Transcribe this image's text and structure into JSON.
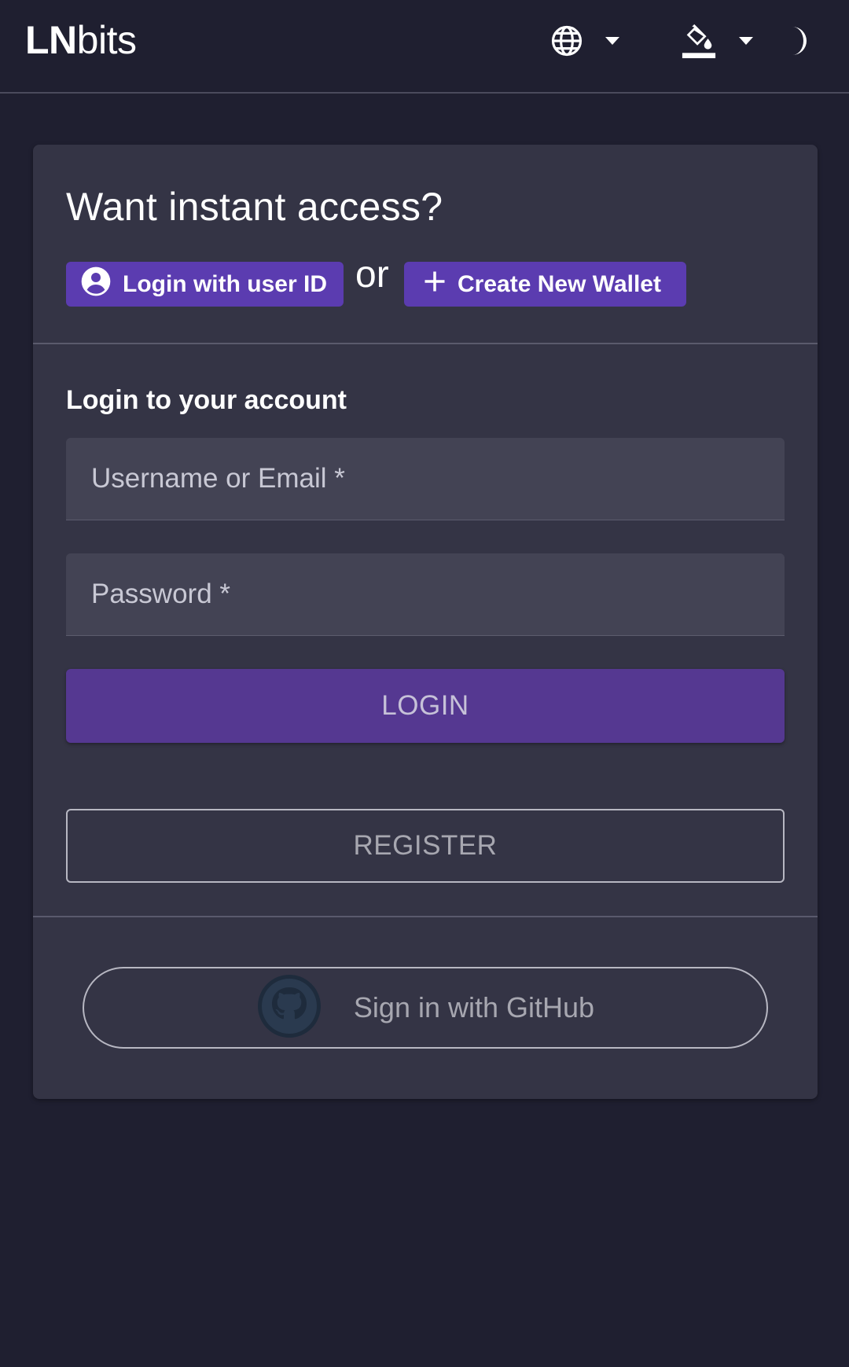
{
  "header": {
    "brand_bold": "LN",
    "brand_light": "bits",
    "icons": [
      "globe-icon",
      "caret-down-icon",
      "paint-bucket-icon",
      "caret-down-icon",
      "moon-icon"
    ]
  },
  "instant_access": {
    "title": "Want instant access?",
    "login_user_id_label": "Login with user ID",
    "or_text": "or",
    "create_wallet_label": "Create New Wallet"
  },
  "login_form": {
    "title": "Login to your account",
    "username_placeholder": "Username or Email *",
    "password_placeholder": "Password *",
    "login_label": "LOGIN",
    "register_label": "REGISTER"
  },
  "oauth": {
    "github_label": "Sign in with GitHub"
  },
  "colors": {
    "background": "#1f1f30",
    "card": "#343445",
    "accent": "#5b3cb0",
    "primary_button": "#553891",
    "input_bg": "#434354"
  }
}
